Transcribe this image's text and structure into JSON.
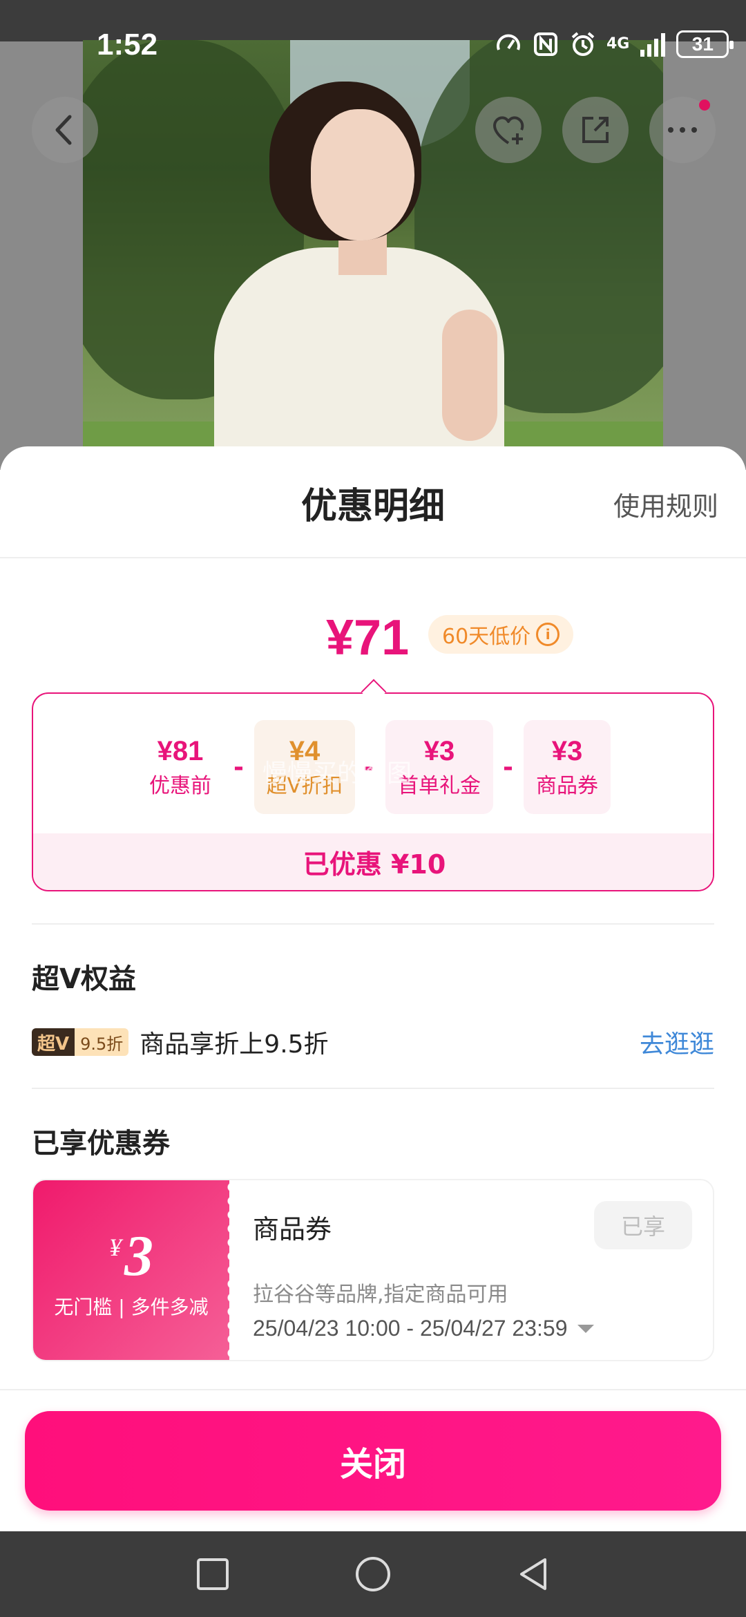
{
  "status_bar": {
    "time": "1:52",
    "network": "4G",
    "battery": "31"
  },
  "product_header": {
    "back_icon": "chevron-left-icon",
    "favorite_icon": "heart-plus-icon",
    "share_icon": "share-icon",
    "more_icon": "more-dots-icon"
  },
  "sheet": {
    "title": "优惠明细",
    "rules_link": "使用规则",
    "final_price": "¥71",
    "low_price_badge": "60天低价",
    "breakdown": [
      {
        "value": "¥81",
        "label": "优惠前"
      },
      {
        "value": "¥4",
        "label": "超V折扣"
      },
      {
        "value": "¥3",
        "label": "首单礼金"
      },
      {
        "value": "¥3",
        "label": "商品券"
      }
    ],
    "operator": "-",
    "saved_text": "已优惠 ¥10",
    "watermark": "慢慢买的图图"
  },
  "vip": {
    "section_title": "超V权益",
    "badge_main": "超V",
    "badge_discount": "9.5折",
    "description": "商品享折上9.5折",
    "link": "去逛逛"
  },
  "coupons": {
    "section_title": "已享优惠券",
    "items": [
      {
        "currency": "¥",
        "amount": "3",
        "condition": "无门槛 | 多件多减",
        "name": "商品券",
        "status": "已享",
        "description": "拉谷谷等品牌,指定商品可用",
        "validity": "25/04/23 10:00 - 25/04/27 23:59"
      }
    ]
  },
  "footer": {
    "close_button": "关闭"
  },
  "colors": {
    "accent": "#e8147a",
    "button": "#ff0f7b",
    "link": "#3f88d8",
    "orange": "#f08a2a"
  }
}
